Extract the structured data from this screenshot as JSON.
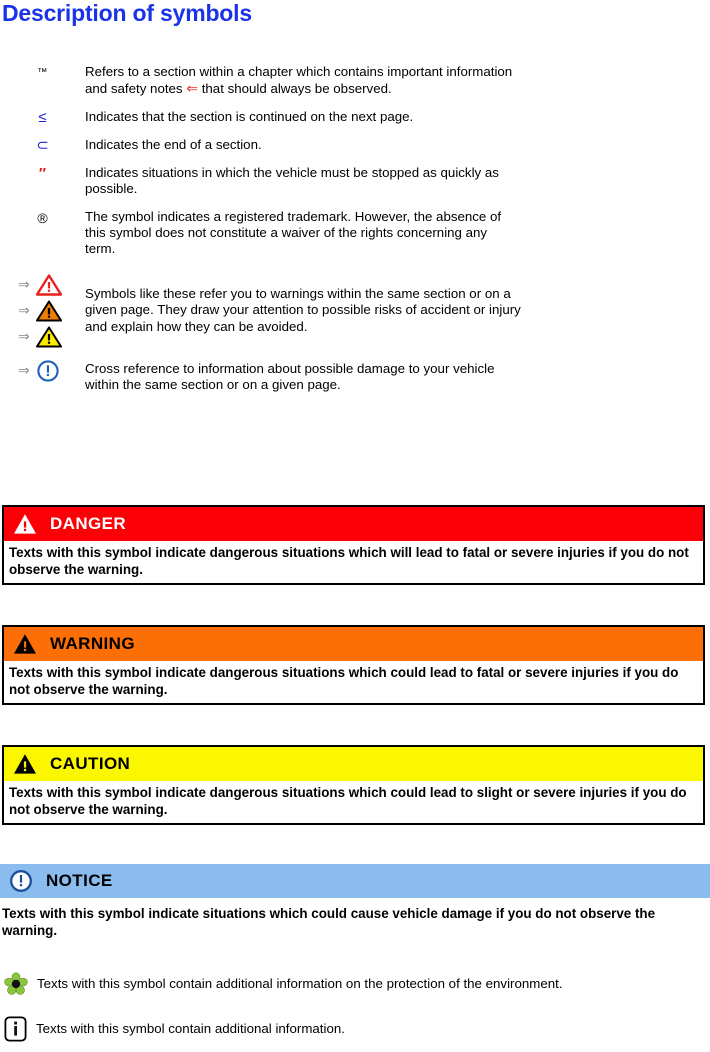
{
  "page": {
    "title": "Description of symbols"
  },
  "legend": {
    "items": [
      {
        "symbol": "™",
        "symbol_name": "trademark-symbol",
        "symbol_color": "#000000",
        "text_before": "Refers to a section within a chapter which contains important information and safety notes ",
        "inline_icon": "⇐",
        "inline_icon_color": "#E83030",
        "text_after": " that should always be observed."
      },
      {
        "symbol": "≤",
        "symbol_name": "continued-next-page-symbol",
        "symbol_color": "#2222DD",
        "text": "Indicates that the section is continued on the next page."
      },
      {
        "symbol": "⊂",
        "symbol_name": "end-of-section-symbol",
        "symbol_color": "#2222DD",
        "text": "Indicates the end of a section."
      },
      {
        "symbol": "″",
        "symbol_name": "stop-vehicle-symbol",
        "symbol_color": "#E02020",
        "text": "Indicates situations in which the vehicle must be stopped as quickly as possible."
      },
      {
        "symbol": "®",
        "symbol_name": "registered-trademark-symbol",
        "symbol_color": "#000000",
        "text": "The symbol indicates a registered trademark. However, the absence of this symbol does not constitute a waiver of the rights concerning any term."
      }
    ],
    "warning_group": {
      "arrow": "⇒",
      "arrow_color": "#888888",
      "icons": [
        "warning-triangle-red-outline",
        "warning-triangle-orange",
        "warning-triangle-yellow"
      ],
      "text": "Symbols like these refer you to warnings within the same section or on a given page. They draw your attention to possible risks of accident or injury and explain how they can be avoided."
    },
    "notice_group": {
      "arrow": "⇒",
      "arrow_color": "#888888",
      "icon": "notice-circle-blue",
      "text": "Cross reference to information about possible damage to your vehicle within the same section or on a given page."
    }
  },
  "alerts": [
    {
      "id": "danger",
      "label": "DANGER",
      "icon": "warning-triangle-icon",
      "header_bg": "#FB0007",
      "title_color": "#FFFFFF",
      "body": "Texts with this symbol indicate dangerous situations which will lead to fatal or severe injuries if you do not observe the warning."
    },
    {
      "id": "warning",
      "label": "WARNING",
      "icon": "warning-triangle-icon",
      "header_bg": "#FC6E06",
      "title_color": "#000000",
      "body": "Texts with this symbol indicate dangerous situations which could lead to fatal or severe injuries if you do not observe the warning."
    },
    {
      "id": "caution",
      "label": "CAUTION",
      "icon": "warning-triangle-icon",
      "header_bg": "#FBF700",
      "title_color": "#000000",
      "body": "Texts with this symbol indicate dangerous situations which could lead to slight or severe injuries if you do not observe the warning."
    }
  ],
  "notice": {
    "label": "NOTICE",
    "icon": "notice-circle-icon",
    "header_bg": "#8BBCEE",
    "body": "Texts with this symbol indicate situations which could cause vehicle damage if you do not observe the warning."
  },
  "footnotes": [
    {
      "icon": "environment-flower-icon",
      "icon_color": "#8CC63E",
      "text": "Texts with this symbol contain additional information on the protection of the environment."
    },
    {
      "icon": "information-icon",
      "icon_color": "#000000",
      "text": "Texts with this symbol contain additional information."
    }
  ]
}
